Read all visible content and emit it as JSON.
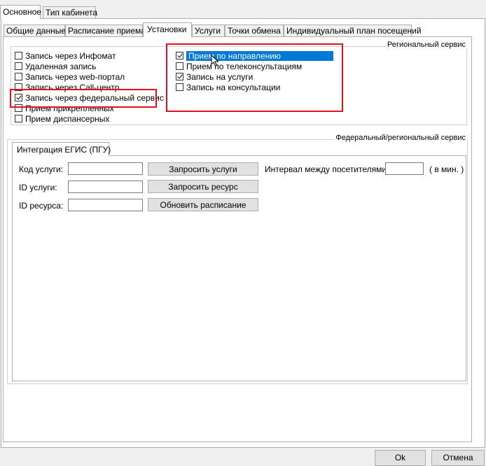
{
  "top_tabs": [
    {
      "label": "Основное"
    },
    {
      "label": "Тип кабинета"
    }
  ],
  "sub_tabs": [
    {
      "label": "Общие данные"
    },
    {
      "label": "Расписание приема"
    },
    {
      "label": "Установки"
    },
    {
      "label": "Услуги"
    },
    {
      "label": "Точки обмена"
    },
    {
      "label": "Индивидуальный план посещений"
    }
  ],
  "regional": {
    "legend": "Региональный сервис",
    "left_items": [
      {
        "label": "Запись через Инфомат",
        "checked": false
      },
      {
        "label": "Удаленная запись",
        "checked": false
      },
      {
        "label": "Запись через web-портал",
        "checked": false
      },
      {
        "label": "Запись через Call-центр",
        "checked": false
      },
      {
        "label": "Запись через федеральный сервис",
        "checked": true
      },
      {
        "label": "Прием прикрепленных",
        "checked": false
      },
      {
        "label": "Прием диспансерных",
        "checked": false
      }
    ],
    "right_items": [
      {
        "label": "Прием по направлению",
        "checked": true
      },
      {
        "label": "Прием по телеконсультациям",
        "checked": false
      },
      {
        "label": "Запись на услуги",
        "checked": true
      },
      {
        "label": "Запись на консультации",
        "checked": false
      }
    ]
  },
  "federal": {
    "legend": "Федеральный/региональный сервис",
    "tab_label": "Интеграция ЕГИС (ПГУ)",
    "service_code_label": "Код услуги:",
    "service_id_label": "ID услуги:",
    "resource_id_label": "ID ресурса:",
    "request_services_button": "Запросить услуги",
    "request_resource_button": "Запросить ресурс",
    "update_schedule_button": "Обновить расписание",
    "interval_label": "Интервал между посетителями:",
    "interval_unit": "( в мин. )",
    "service_code_value": "",
    "service_id_value": "",
    "resource_id_value": "",
    "interval_value": ""
  },
  "footer": {
    "ok_label": "Ok",
    "cancel_label": "Отмена"
  },
  "colors": {
    "selection": "#0078d7",
    "highlight_box": "#e0101e",
    "background": "#f0f0f0"
  }
}
